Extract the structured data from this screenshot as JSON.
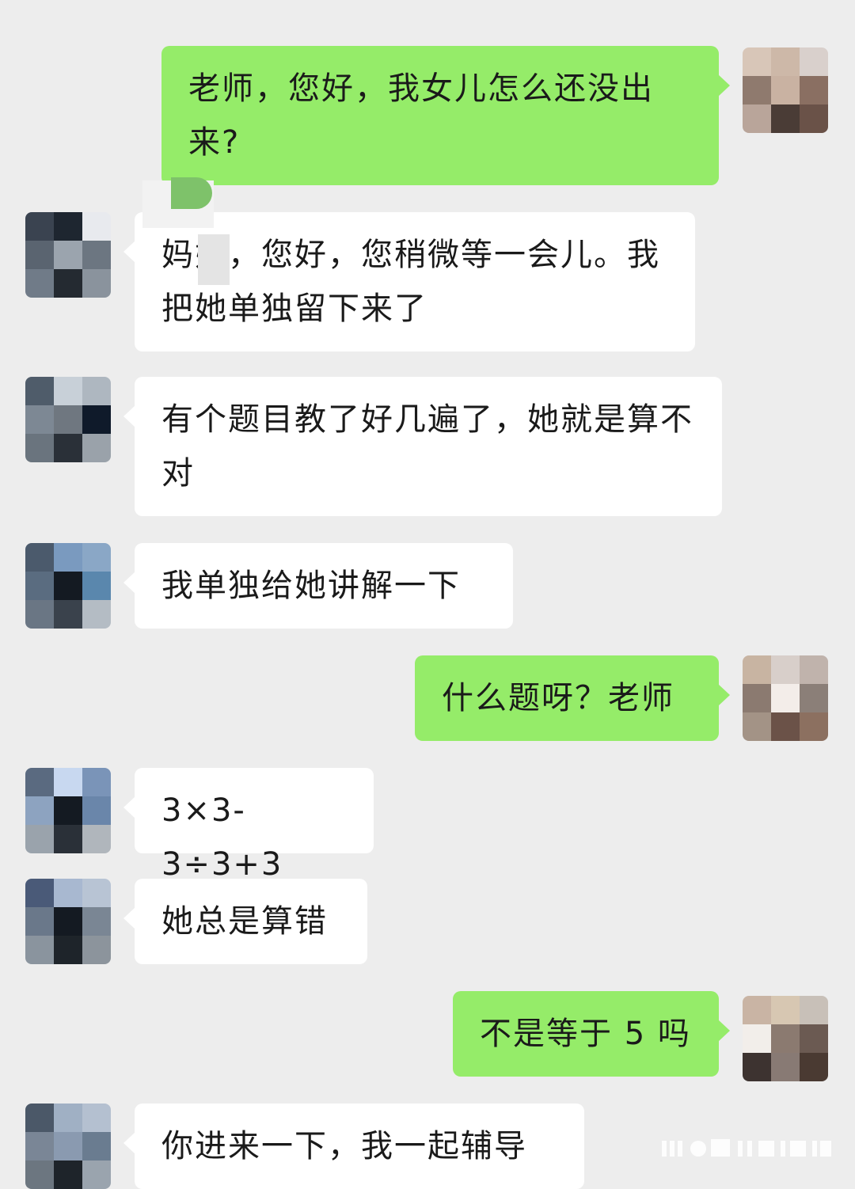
{
  "colors": {
    "background": "#ededed",
    "incoming_bubble": "#ffffff",
    "outgoing_bubble": "#95ec69"
  },
  "messages": [
    {
      "sender": "parent",
      "text": "老师，您好，我女儿怎么还没出来?"
    },
    {
      "sender": "teacher",
      "text": "妈妈，您好，您稍微等一会儿。我把她单独留下来了"
    },
    {
      "sender": "teacher",
      "text": "有个题目教了好几遍了，她就是算不对"
    },
    {
      "sender": "teacher",
      "text": "我单独给她讲解一下"
    },
    {
      "sender": "parent",
      "text": "什么题呀？老师"
    },
    {
      "sender": "teacher",
      "text": "3×3-3÷3+3"
    },
    {
      "sender": "teacher",
      "text": "她总是算错"
    },
    {
      "sender": "parent",
      "text": "不是等于 5 吗"
    },
    {
      "sender": "teacher",
      "text": "你进来一下，我一起辅导"
    }
  ],
  "icons": {
    "parent_avatar": "blurred-avatar-icon",
    "teacher_avatar": "blurred-avatar-icon"
  }
}
